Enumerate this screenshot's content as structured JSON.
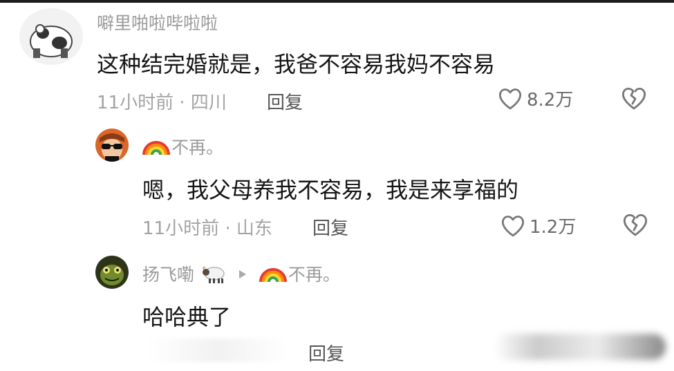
{
  "comments": [
    {
      "username": "噼里啪啦哔啦啦",
      "content": "这种结完婚就是，我爸不容易我妈不容易",
      "time_location": "11小时前 · 四川",
      "reply_label": "回复",
      "likes": "8.2万"
    },
    {
      "username": "不再。",
      "content": "嗯，我父母养我不容易，我是来享福的",
      "time_location": "11小时前 · 山东",
      "reply_label": "回复",
      "likes": "1.2万"
    },
    {
      "username": "扬飞嘞",
      "reply_to": "不再。",
      "content": "哈哈典了",
      "reply_label": "回复"
    }
  ],
  "icons": {
    "like": "heart-outline-icon",
    "dislike": "broken-heart-icon",
    "rainbow": "rainbow-emoji",
    "sheep": "sheep-emoji",
    "reply_arrow": "triangle-right-icon"
  },
  "colors": {
    "username": "#9a9a9a",
    "content": "#151515",
    "meta": "#a3a3a3"
  }
}
